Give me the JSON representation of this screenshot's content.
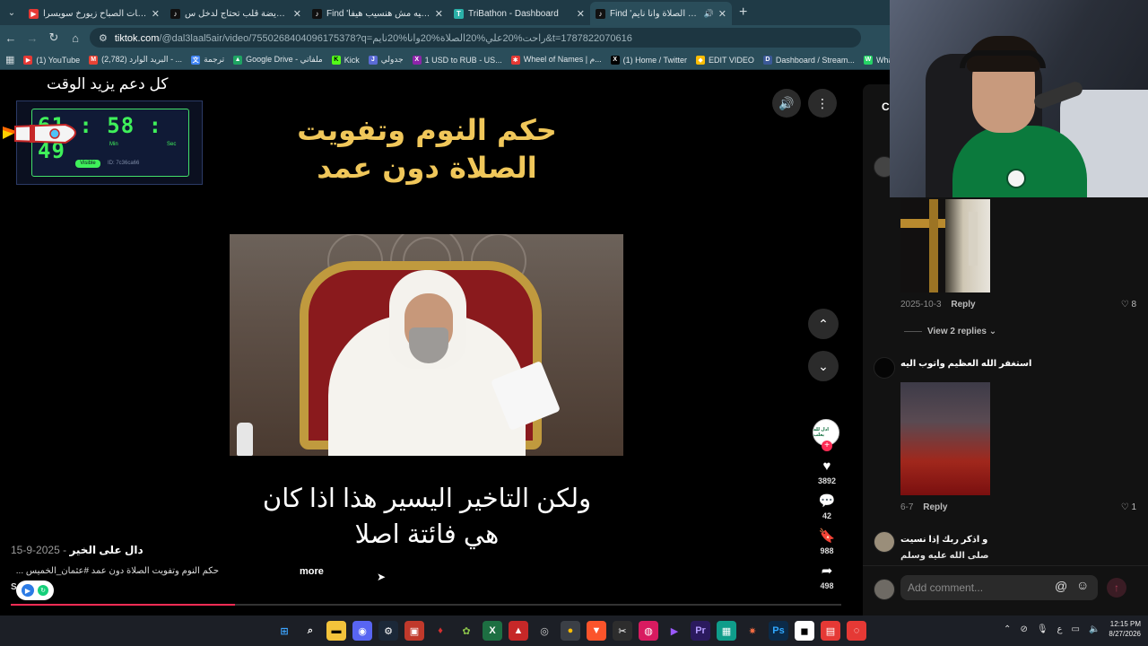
{
  "browser": {
    "tabs": [
      {
        "title": "فيروزيات الصباح زيورخ سويسرا",
        "fav_color": "#e53935",
        "fav_glyph": "▶",
        "active": false
      },
      {
        "title": "امرأة مريضة قلب تحتاج لدخل س...",
        "fav_color": "#111111",
        "fav_glyph": "♪",
        "active": false
      },
      {
        "title": "Find 'سك فيه مش هنسيب هيفا'",
        "fav_color": "#111111",
        "fav_glyph": "♪",
        "active": false
      },
      {
        "title": "TriBathon - Dashboard",
        "fav_color": "#2bb0a8",
        "fav_glyph": "T",
        "active": false
      },
      {
        "title": "Find 'راحت علي الصلاة وانا نايم'",
        "fav_color": "#111111",
        "fav_glyph": "♪",
        "active": true
      }
    ],
    "url_host": "tiktok.com",
    "url_path": "/@dal3laal5air/video/7550268404096175378?q=راحت%20علي%20الصلاة%20وانا%20نايم&t=1787822070616",
    "bookmarks": [
      {
        "label": "(1) YouTube",
        "color": "#e53935",
        "glyph": "▶"
      },
      {
        "label": "(2,782) البريد الوارد - ...",
        "color": "#ea4335",
        "glyph": "M"
      },
      {
        "label": "ترجمة",
        "color": "#4285f4",
        "glyph": "文"
      },
      {
        "label": "Google Drive - ملفاتي",
        "color": "#1fa463",
        "glyph": "▲"
      },
      {
        "label": "Kick",
        "color": "#53fc18",
        "glyph": "K"
      },
      {
        "label": "جدولي",
        "color": "#5b6bd6",
        "glyph": "J"
      },
      {
        "label": "1 USD to RUB - US...",
        "color": "#8e24aa",
        "glyph": "X"
      },
      {
        "label": "Wheel of Names | م...",
        "color": "#e53935",
        "glyph": "✱"
      },
      {
        "label": "(1) Home / Twitter",
        "color": "#000000",
        "glyph": "X"
      },
      {
        "label": "EDIT VIDEO",
        "color": "#fbbc04",
        "glyph": "◆"
      },
      {
        "label": "Dashboard / Stream...",
        "color": "#3b5998",
        "glyph": "D"
      },
      {
        "label": "WhatsApp",
        "color": "#25d366",
        "glyph": "W"
      },
      {
        "label": "D",
        "color": "#5865f2",
        "glyph": "R"
      }
    ]
  },
  "overlay": {
    "caption": "كل دعم يزيد الوقت",
    "timer_digits": "61 : 58 : 49",
    "timer_unit_sec": "Sec",
    "timer_unit_min": "Min",
    "timer_button": "Visible",
    "timer_id": "ID: 7c36ca66"
  },
  "video": {
    "title_line1": "حكم النوم وتفويت",
    "title_line2": "الصلاة دون عمد",
    "caption_line1": "ولكن التاخير اليسير هذا اذا كان",
    "caption_line2": "هي فائتة اصلا",
    "author": "دال على الخير",
    "date": "2025-9-15",
    "description": "حكم النوم وتفويت الصلاة دون عمد #عثمان_الخميس ...",
    "more_label": "more",
    "sound_label": "S... lation",
    "progress": 0.27,
    "likes": "3892",
    "comments": "42",
    "saves": "988",
    "shares": "498",
    "account_avatar_text": "ادل لله يعلب"
  },
  "comments_panel": {
    "tab_label": "C",
    "items": [
      {
        "date": "2025-10-3",
        "reply": "Reply",
        "likes": "8"
      },
      {
        "view_replies": "View 2 replies"
      },
      {
        "text": "استغفر الله العظيم واتوب اليه",
        "date": "6-7",
        "reply": "Reply",
        "likes": "1"
      },
      {
        "text": "و اذكر ربك إذا نسيت",
        "text2": "صلى الله عليه وسلم"
      }
    ],
    "input_placeholder": "Add comment...",
    "at_glyph": "@",
    "emoji_glyph": "☺",
    "send_glyph": "↑"
  },
  "taskbar": {
    "time": "12:15 PM",
    "date": "8/27/2026",
    "lang": "ع"
  }
}
